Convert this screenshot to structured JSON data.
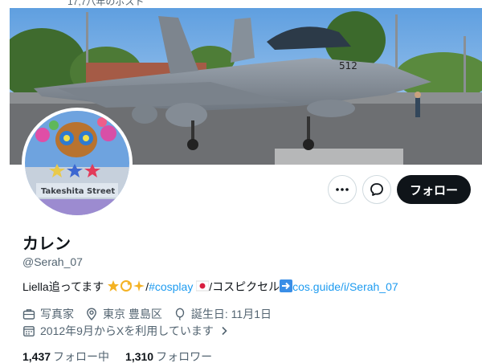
{
  "top_cut_text": "17,7八年のポスト",
  "profile": {
    "name": "カレン",
    "handle": "@Serah_07",
    "avatar_text": "Takeshita Street",
    "banner_tail_number": "512"
  },
  "actions": {
    "follow_label": "フォロー"
  },
  "bio": {
    "text1": "Liella追ってます",
    "sep1": "/",
    "hashtag": "#cosplay",
    "text2": "/コスピクセル",
    "link": "cos.guide/i/Serah_07"
  },
  "meta": {
    "category": "写真家",
    "location": "東京 豊島区",
    "birthday": "誕生日: 11月1日",
    "joined": "2012年9月からXを利用しています"
  },
  "stats": {
    "following_count": "1,437",
    "following_label": "フォロー中",
    "followers_count": "1,310",
    "followers_label": "フォロワー"
  },
  "colors": {
    "accent": "#1d9bf0",
    "text": "#0f1419",
    "muted": "#536471",
    "button_dark": "#0f1419"
  }
}
